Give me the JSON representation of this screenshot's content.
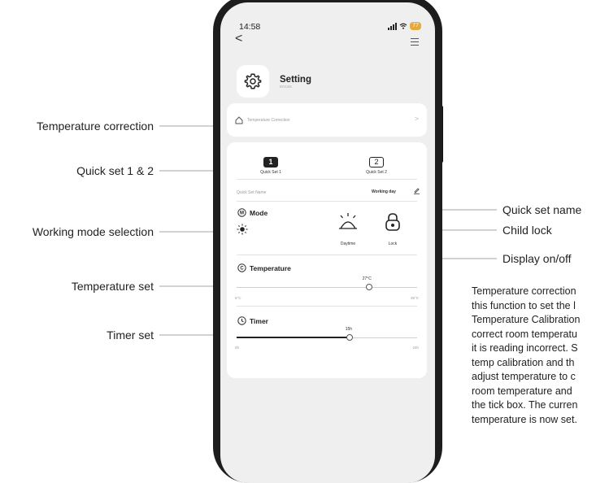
{
  "status": {
    "time": "14:58",
    "battery": "77"
  },
  "header": {
    "title": "Setting",
    "subtitle": "MYLEK"
  },
  "temp_correction_row": {
    "label": "Temperature Correction"
  },
  "quick_set": {
    "tab1_number": "1",
    "tab1_label": "Quick Set 1",
    "tab2_number": "2",
    "tab2_label": "Quick Set 2",
    "name_label": "Quick Set Name",
    "name_value": "Working day"
  },
  "mode": {
    "label": "Mode",
    "display_label": "Daytime",
    "lock_label": "Lock"
  },
  "temperature": {
    "label": "Temperature",
    "value": "27°C",
    "min": "5°C",
    "max": "35°C",
    "fraction": 0.733
  },
  "timer": {
    "label": "Timer",
    "value": "15h",
    "min": "0h",
    "max": "24h",
    "fraction": 0.625
  },
  "annotations": {
    "temp_correction": "Temperature correction",
    "quick_set": "Quick set 1 & 2",
    "working_mode": "Working mode selection",
    "temp_set": "Temperature set",
    "timer_set": "Timer set",
    "quick_set_name": "Quick set name",
    "child_lock": "Child lock",
    "display": "Display on/off"
  },
  "description_lines": [
    "Temperature correction",
    "this function to set the l",
    "Temperature Calibration",
    "correct room temperatu",
    "it is reading incorrect. S",
    "temp calibration and th",
    "adjust temperature to c",
    "room temperature and",
    "the tick box. The curren",
    "temperature is now set."
  ]
}
